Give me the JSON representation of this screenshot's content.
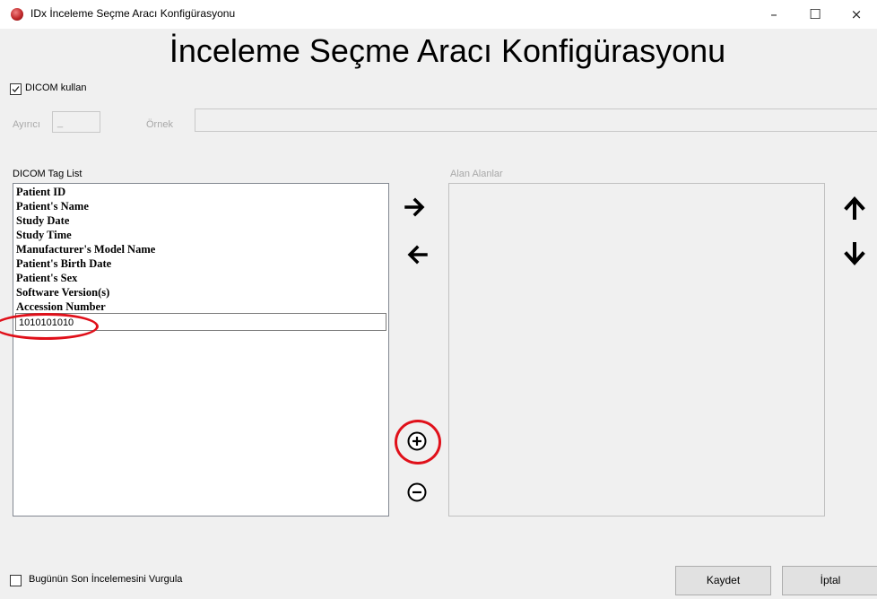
{
  "window": {
    "title": "IDx İnceleme Seçme Aracı Konfigürasyonu",
    "controls": {
      "minimize": "–",
      "maximize": "☐",
      "close": "×"
    }
  },
  "header": {
    "title": "İnceleme Seçme Aracı Konfigürasyonu"
  },
  "dicom": {
    "use_label": "DICOM kullan",
    "checked": true
  },
  "separator": {
    "label": "Ayırıcı",
    "value": "_"
  },
  "example": {
    "label": "Örnek",
    "value": ""
  },
  "tag_list": {
    "label": "DICOM Tag List",
    "items": [
      "Patient ID",
      "Patient's Name",
      "Study Date",
      "Study Time",
      "Manufacturer's Model Name",
      "Patient's Birth Date",
      "Patient's Sex",
      "Software Version(s)",
      "Accession Number"
    ],
    "edit_value": "1010101010"
  },
  "fields": {
    "label": "Alan Alanlar"
  },
  "buttons": {
    "add_arrow": "right-arrow-icon",
    "remove_arrow": "left-arrow-icon",
    "plus": "plus-circle-icon",
    "minus": "minus-circle-icon",
    "up": "up-arrow-icon",
    "down": "down-arrow-icon"
  },
  "footer": {
    "highlight_label": "Bugünün Son İncelemesini Vurgula",
    "highlight_checked": false,
    "save": "Kaydet",
    "cancel": "İptal"
  },
  "annotation_color": "#e0101a"
}
